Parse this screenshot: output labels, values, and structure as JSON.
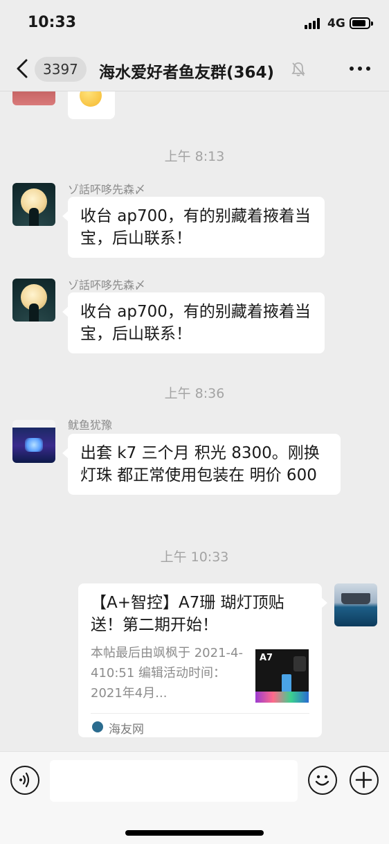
{
  "status_bar": {
    "time": "10:33",
    "network": "4G"
  },
  "nav": {
    "unread_count": "3397",
    "title": "海水爱好者鱼友群(364)"
  },
  "messages": {
    "time1": "上午 8:13",
    "msg1": {
      "sender": "ゾ話吥哆先森〆",
      "text": "收台 ap700，有的别藏着掖着当宝，后山联系！"
    },
    "msg2": {
      "sender": "ゾ話吥哆先森〆",
      "text": "收台 ap700，有的别藏着掖着当宝，后山联系！"
    },
    "time2": "上午 8:36",
    "msg3": {
      "sender": "鱿鱼犹豫",
      "text": "出套 k7 三个月  积光 8300。刚换灯珠    都正常使用包装在   明价 600"
    },
    "time3": "上午 10:33",
    "card": {
      "title": "【A+智控】A7珊 瑚灯顶贴送！第二期开始！",
      "description": "本帖最后由飒枫于 2021-4-410:51 编辑活动时间： 2021年4月...",
      "thumb_brand": "A7",
      "source": "海友网"
    }
  },
  "icons": {
    "back": "chevron-left-icon",
    "mute": "bell-slash-icon",
    "more": "more-dots-icon",
    "voice": "voice-icon",
    "emoji": "emoji-icon",
    "add": "plus-icon"
  },
  "colors": {
    "background": "#ededed",
    "bubble": "#ffffff",
    "time_label": "#a3a3a3"
  }
}
